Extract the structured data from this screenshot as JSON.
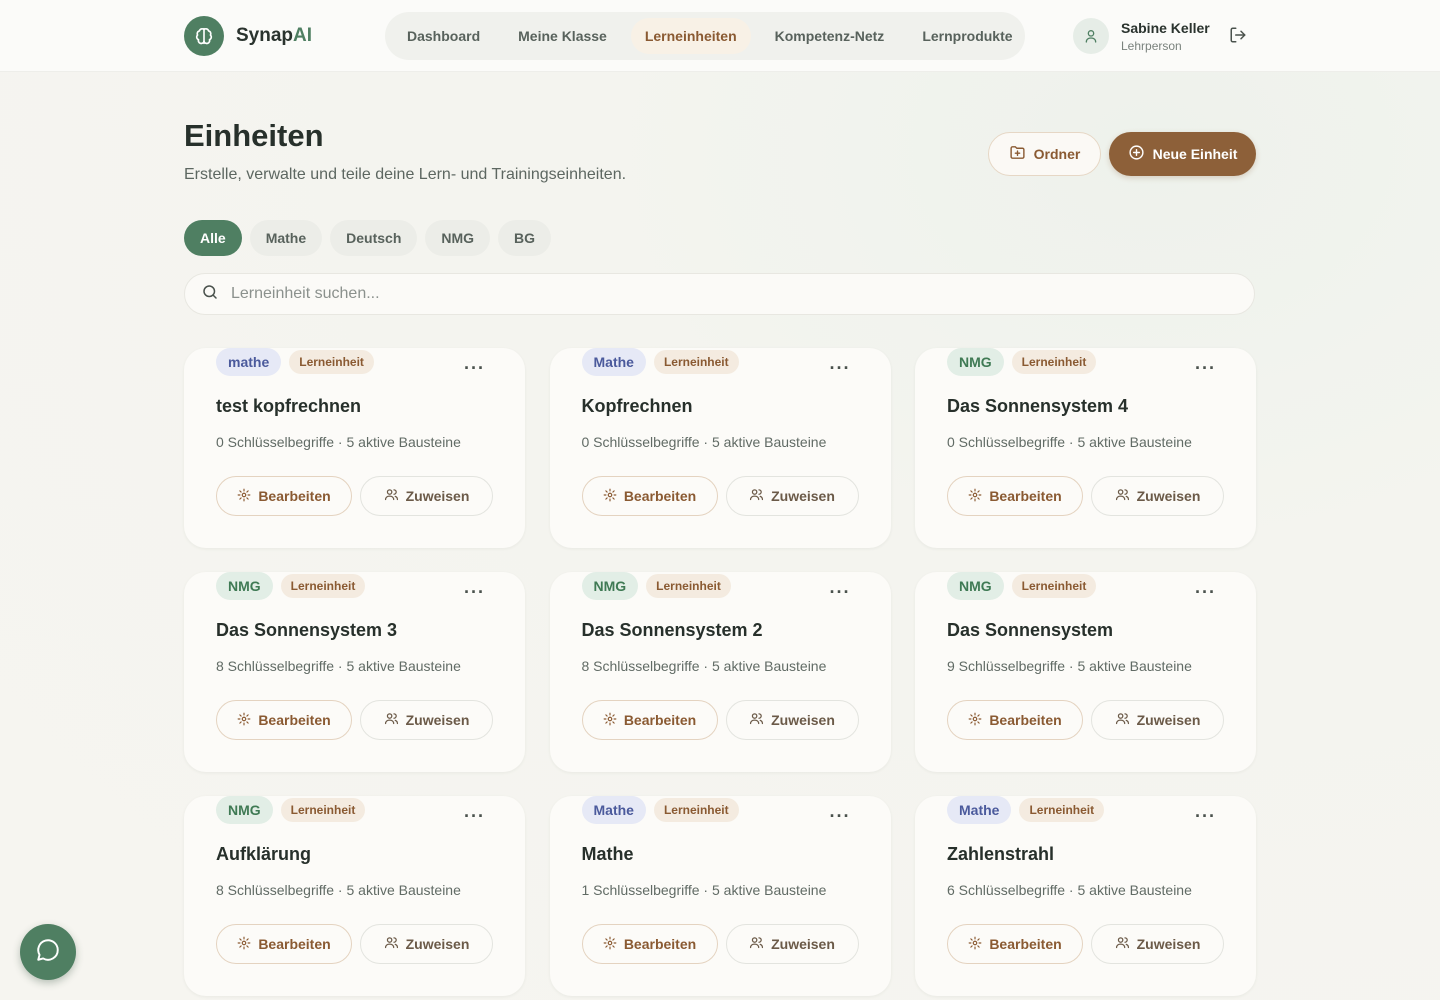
{
  "app": {
    "name_main": "Synap",
    "name_accent": "AI"
  },
  "nav": {
    "items": [
      {
        "label": "Dashboard",
        "active": false
      },
      {
        "label": "Meine Klasse",
        "active": false
      },
      {
        "label": "Lerneinheiten",
        "active": true
      },
      {
        "label": "Kompetenz-Netz",
        "active": false
      },
      {
        "label": "Lernprodukte",
        "active": false
      }
    ]
  },
  "user": {
    "name": "Sabine Keller",
    "role": "Lehrperson"
  },
  "header": {
    "title": "Einheiten",
    "subtitle": "Erstelle, verwalte und teile deine Lern- und Trainingseinheiten.",
    "folder_label": "Ordner",
    "new_label": "Neue Einheit"
  },
  "filters": [
    {
      "label": "Alle",
      "active": true
    },
    {
      "label": "Mathe",
      "active": false
    },
    {
      "label": "Deutsch",
      "active": false
    },
    {
      "label": "NMG",
      "active": false
    },
    {
      "label": "BG",
      "active": false
    }
  ],
  "search": {
    "placeholder": "Lerneinheit suchen...",
    "value": ""
  },
  "card_actions": {
    "edit": "Bearbeiten",
    "assign": "Zuweisen",
    "more": "···"
  },
  "cards": [
    {
      "subject": "mathe",
      "subject_class": "mathe",
      "type": "Lerneinheit",
      "title": "test kopfrechnen",
      "meta": "0 Schlüsselbegriffe · 5 aktive Bausteine"
    },
    {
      "subject": "Mathe",
      "subject_class": "mathe",
      "type": "Lerneinheit",
      "title": "Kopfrechnen",
      "meta": "0 Schlüsselbegriffe · 5 aktive Bausteine"
    },
    {
      "subject": "NMG",
      "subject_class": "nmg",
      "type": "Lerneinheit",
      "title": "Das Sonnensystem 4",
      "meta": "0 Schlüsselbegriffe · 5 aktive Bausteine"
    },
    {
      "subject": "NMG",
      "subject_class": "nmg",
      "type": "Lerneinheit",
      "title": "Das Sonnensystem 3",
      "meta": "8 Schlüsselbegriffe · 5 aktive Bausteine"
    },
    {
      "subject": "NMG",
      "subject_class": "nmg",
      "type": "Lerneinheit",
      "title": "Das Sonnensystem 2",
      "meta": "8 Schlüsselbegriffe · 5 aktive Bausteine"
    },
    {
      "subject": "NMG",
      "subject_class": "nmg",
      "type": "Lerneinheit",
      "title": "Das Sonnensystem",
      "meta": "9 Schlüsselbegriffe · 5 aktive Bausteine"
    },
    {
      "subject": "NMG",
      "subject_class": "nmg",
      "type": "Lerneinheit",
      "title": "Aufklärung",
      "meta": "8 Schlüsselbegriffe · 5 aktive Bausteine"
    },
    {
      "subject": "Mathe",
      "subject_class": "mathe",
      "type": "Lerneinheit",
      "title": "Mathe",
      "meta": "1 Schlüsselbegriffe · 5 aktive Bausteine"
    },
    {
      "subject": "Mathe",
      "subject_class": "mathe",
      "type": "Lerneinheit",
      "title": "Zahlenstrahl",
      "meta": "6 Schlüsselbegriffe · 5 aktive Bausteine"
    }
  ],
  "colors": {
    "brand_green": "#4f7f62",
    "brand_brown": "#8d6039"
  },
  "icons": {
    "logo": "brain-icon",
    "user": "user-icon",
    "logout": "logout-icon",
    "folder": "folder-plus-icon",
    "new": "plus-circle-icon",
    "search": "search-icon",
    "edit": "gear-icon",
    "assign": "users-icon",
    "chat": "chat-bubble-icon"
  }
}
